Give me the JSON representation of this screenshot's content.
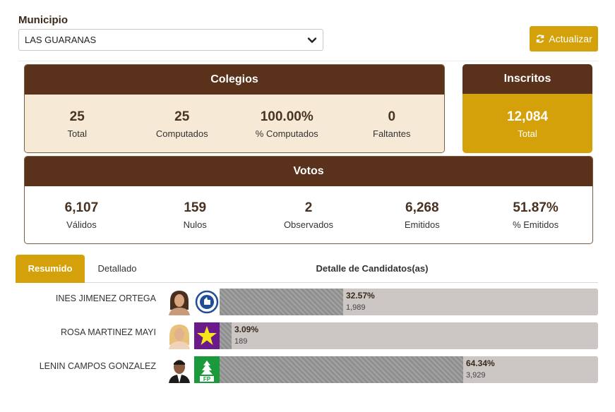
{
  "municipio": {
    "label": "Municipio",
    "selected": "LAS GUARANAS"
  },
  "actualizar_label": "Actualizar",
  "colegios": {
    "title": "Colegios",
    "stats": [
      {
        "value": "25",
        "label": "Total"
      },
      {
        "value": "25",
        "label": "Computados"
      },
      {
        "value": "100.00%",
        "label": "% Computados"
      },
      {
        "value": "0",
        "label": "Faltantes"
      }
    ]
  },
  "inscritos": {
    "title": "Inscritos",
    "value": "12,084",
    "label": "Total"
  },
  "votos": {
    "title": "Votos",
    "stats": [
      {
        "value": "6,107",
        "label": "Válidos"
      },
      {
        "value": "159",
        "label": "Nulos"
      },
      {
        "value": "2",
        "label": "Observados"
      },
      {
        "value": "6,268",
        "label": "Emitidos"
      },
      {
        "value": "51.87%",
        "label": "% Emitidos"
      }
    ]
  },
  "tabs": {
    "resumen": "Resumido",
    "detallado": "Detallado",
    "detalle_title": "Detalle de Candidatos(as)"
  },
  "candidates": [
    {
      "name": "INES JIMENEZ ORTEGA",
      "percent_label": "32.57%",
      "percent": 32.57,
      "votes": "1,989",
      "party_icon": "prd-party-logo",
      "party_color": "#1e4e96"
    },
    {
      "name": "ROSA MARTINEZ MAYI",
      "percent_label": "3.09%",
      "percent": 3.09,
      "votes": "189",
      "party_icon": "star-party-logo",
      "party_color": "#6a1a8a"
    },
    {
      "name": "LENIN CAMPOS GONZALEZ",
      "percent_label": "64.34%",
      "percent": 64.34,
      "votes": "3,929",
      "party_icon": "fp-party-logo",
      "party_color": "#1a9a3a",
      "logo_text": "FP"
    }
  ],
  "colors": {
    "brown": "#5a311b",
    "gold": "#d4a10a",
    "cream": "#f6ead6",
    "bar_bg": "#ccc6c4",
    "bar_fill": "#8f8f8f"
  }
}
